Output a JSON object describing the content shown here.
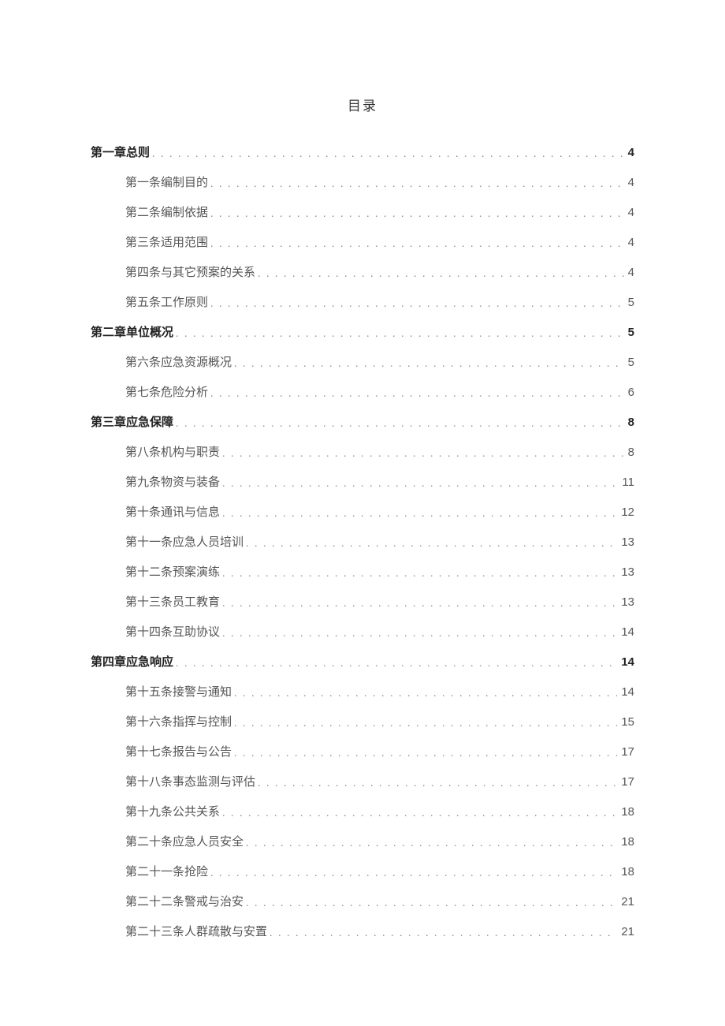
{
  "title": "目录",
  "toc": {
    "chapters": [
      {
        "label": "第一章总则",
        "page": "4",
        "items": [
          {
            "label": "第一条编制目的",
            "page": "4"
          },
          {
            "label": "第二条编制依据",
            "page": "4"
          },
          {
            "label": "第三条适用范围",
            "page": "4"
          },
          {
            "label": "第四条与其它预案的关系",
            "page": "4"
          },
          {
            "label": "第五条工作原则",
            "page": "5"
          }
        ]
      },
      {
        "label": "第二章单位概况",
        "page": "5",
        "items": [
          {
            "label": "第六条应急资源概况",
            "page": "5"
          },
          {
            "label": "第七条危险分析",
            "page": "6"
          }
        ]
      },
      {
        "label": "第三章应急保障",
        "page": "8",
        "items": [
          {
            "label": "第八条机构与职责",
            "page": "8"
          },
          {
            "label": "第九条物资与装备",
            "page": "11"
          },
          {
            "label": "第十条通讯与信息",
            "page": "12"
          },
          {
            "label": "第十一条应急人员培训",
            "page": "13"
          },
          {
            "label": "第十二条预案演练",
            "page": "13"
          },
          {
            "label": "第十三条员工教育",
            "page": "13"
          },
          {
            "label": "第十四条互助协议",
            "page": "14"
          }
        ]
      },
      {
        "label": "第四章应急响应",
        "page": "14",
        "items": [
          {
            "label": "第十五条接警与通知",
            "page": "14"
          },
          {
            "label": "第十六条指挥与控制",
            "page": "15"
          },
          {
            "label": "第十七条报告与公告",
            "page": "17"
          },
          {
            "label": "第十八条事态监测与评估",
            "page": "17"
          },
          {
            "label": "第十九条公共关系",
            "page": "18"
          },
          {
            "label": "第二十条应急人员安全",
            "page": "18"
          },
          {
            "label": "第二十一条抢险",
            "page": "18"
          },
          {
            "label": "第二十二条警戒与治安",
            "page": "21"
          },
          {
            "label": "第二十三条人群疏散与安置",
            "page": "21"
          }
        ]
      }
    ]
  }
}
